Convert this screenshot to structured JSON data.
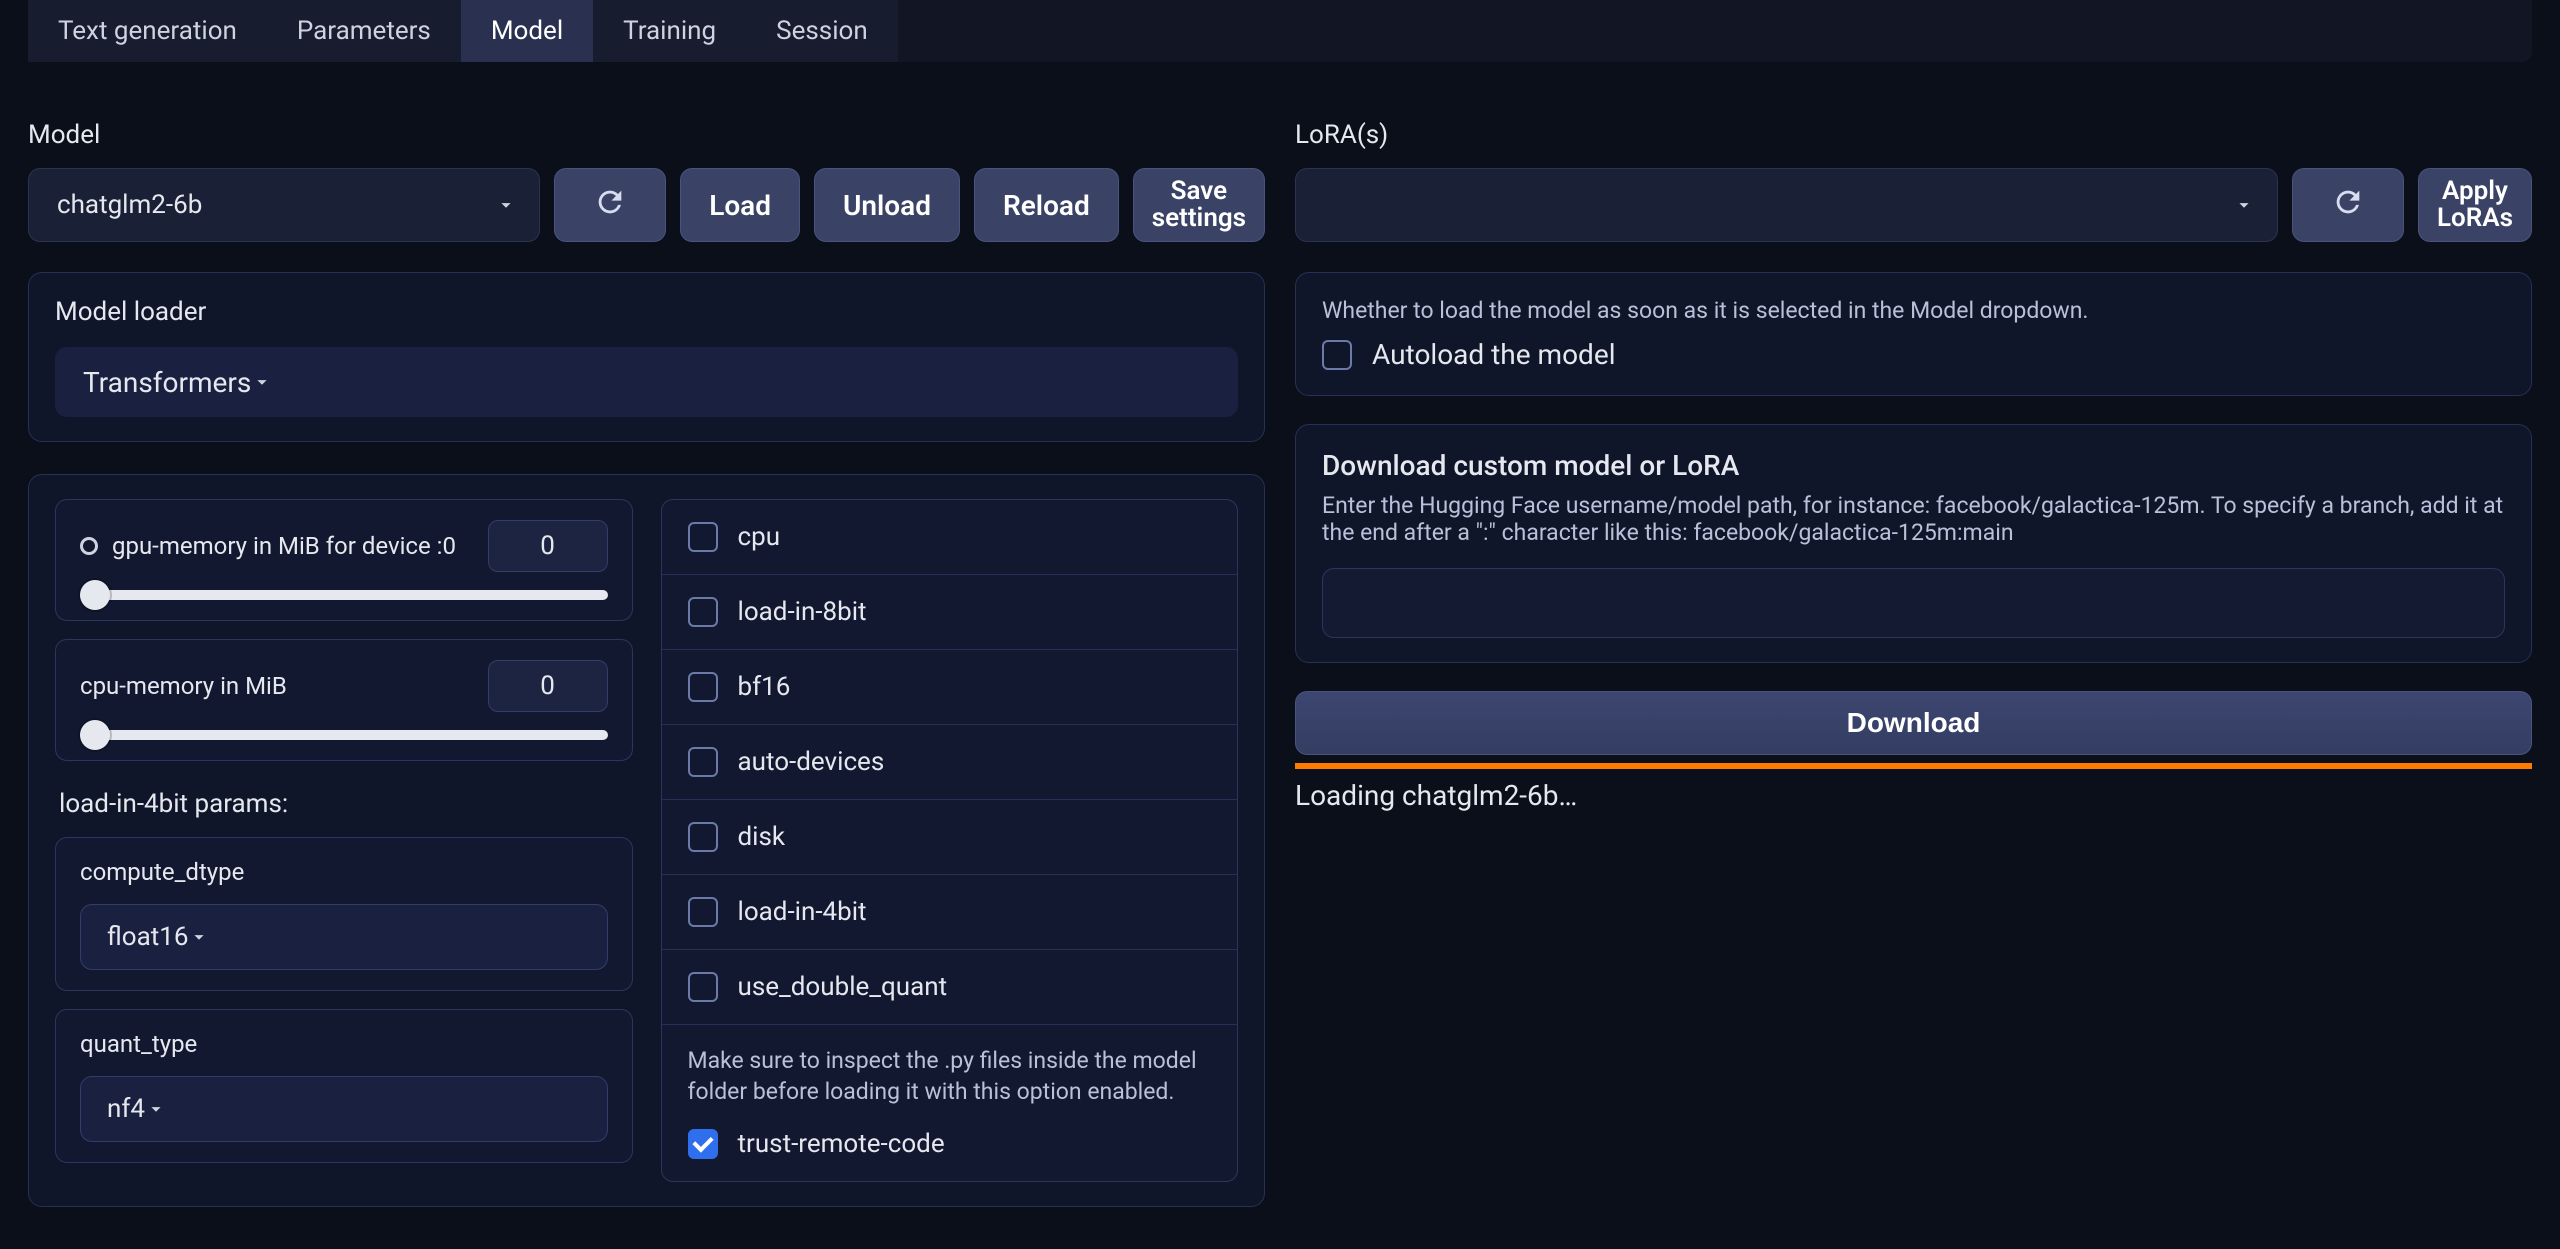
{
  "tabs": [
    "Text generation",
    "Parameters",
    "Model",
    "Training",
    "Session"
  ],
  "active_tab_index": 2,
  "left": {
    "model_label": "Model",
    "model_selected": "chatglm2-6b",
    "buttons": {
      "load": "Load",
      "unload": "Unload",
      "reload": "Reload",
      "save_l1": "Save",
      "save_l2": "settings"
    },
    "loader": {
      "label": "Model loader",
      "value": "Transformers"
    },
    "mem": {
      "gpu_label": "gpu-memory in MiB for device :0",
      "gpu_value": "0",
      "cpu_label": "cpu-memory in MiB",
      "cpu_value": "0"
    },
    "four_bit_title": "load-in-4bit params:",
    "compute": {
      "label": "compute_dtype",
      "value": "float16"
    },
    "quant": {
      "label": "quant_type",
      "value": "nf4"
    },
    "flags": {
      "cpu": "cpu",
      "load8": "load-in-8bit",
      "bf16": "bf16",
      "auto": "auto-devices",
      "disk": "disk",
      "load4": "load-in-4bit",
      "dblq": "use_double_quant",
      "trust_hint": "Make sure to inspect the .py files inside the model folder before loading it with this option enabled.",
      "trust": "trust-remote-code"
    }
  },
  "right": {
    "loras_label": "LoRA(s)",
    "loras_value": "",
    "apply_l1": "Apply",
    "apply_l2": "LoRAs",
    "autoload": {
      "hint": "Whether to load the model as soon as it is selected in the Model dropdown.",
      "label": "Autoload the model",
      "checked": false
    },
    "download": {
      "title": "Download custom model or LoRA",
      "hint": "Enter the Hugging Face username/model path, for instance: facebook/galactica-125m. To specify a branch, add it at the end after a \":\" character like this: facebook/galactica-125m:main",
      "value": "",
      "button": "Download"
    },
    "status": "Loading chatglm2-6b…"
  }
}
